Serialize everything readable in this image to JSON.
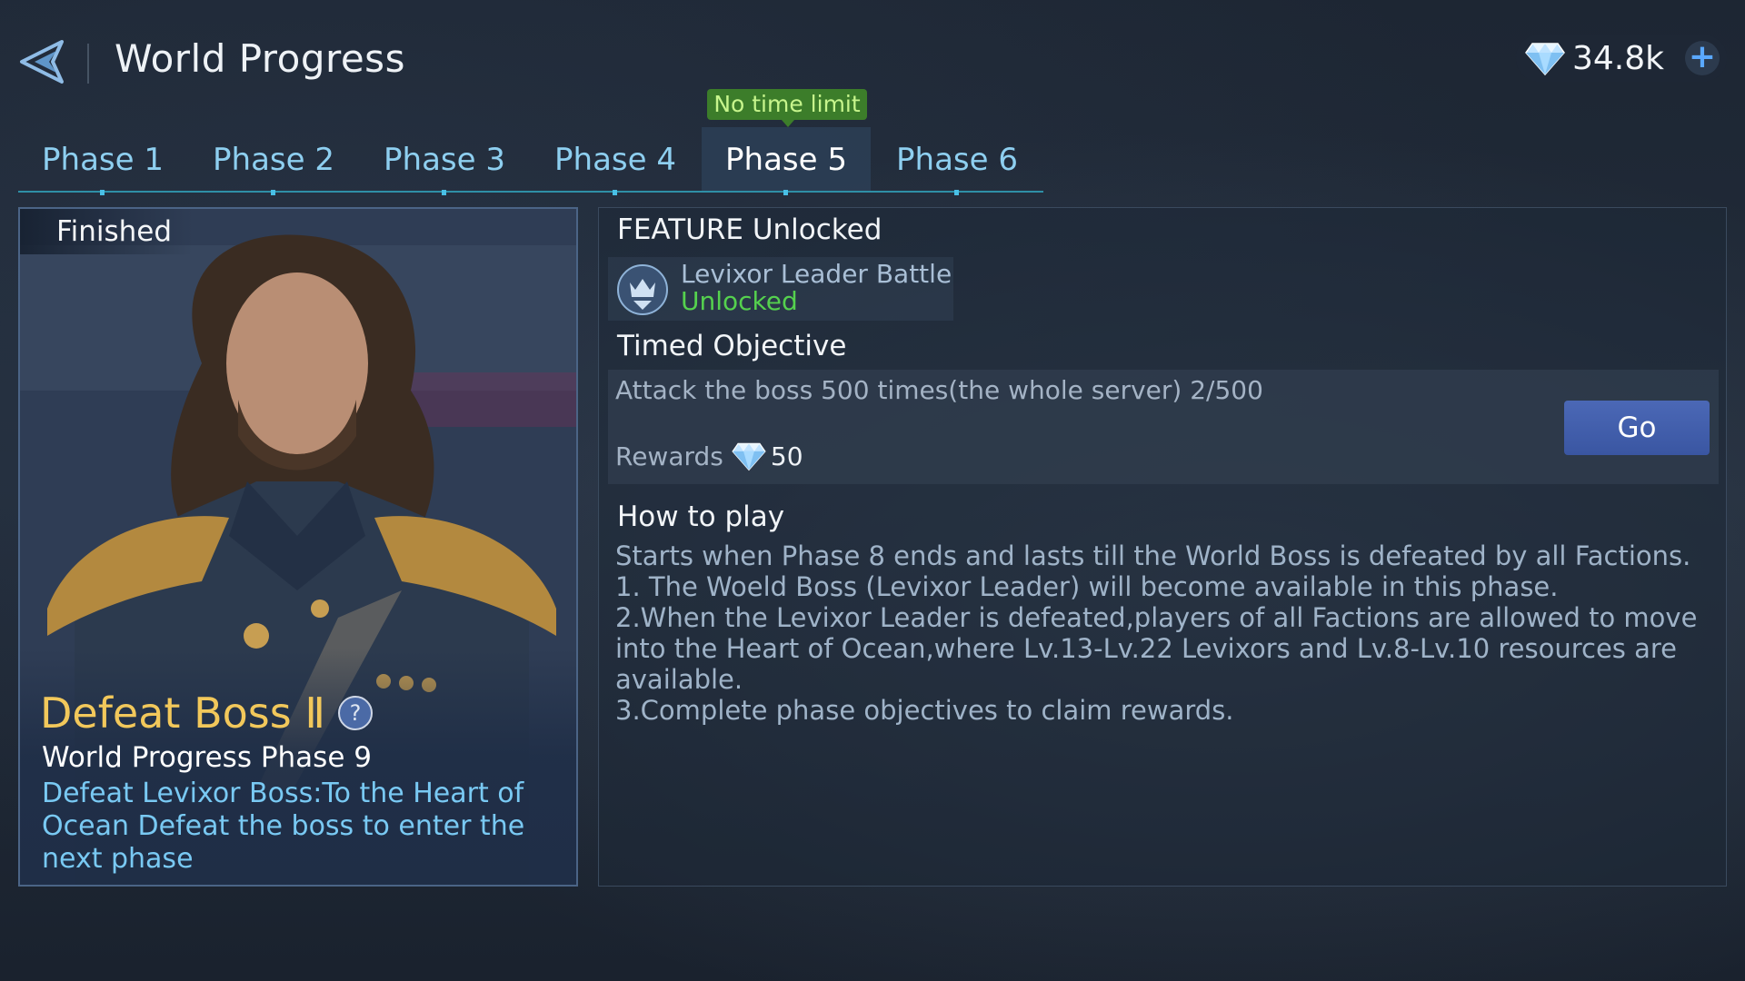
{
  "header": {
    "title": "World Progress",
    "currency_amount": "34.8k",
    "plus_label": "+"
  },
  "tabs": {
    "items": [
      {
        "label": "Phase 1"
      },
      {
        "label": "Phase 2"
      },
      {
        "label": "Phase 3"
      },
      {
        "label": "Phase 4"
      },
      {
        "label": "Phase 5"
      },
      {
        "label": "Phase 6"
      }
    ],
    "active": "Phase 5",
    "badge": "No time limit"
  },
  "card": {
    "status": "Finished",
    "boss_title": "Defeat Boss Ⅱ",
    "help_label": "?",
    "subtitle": "World Progress Phase 9",
    "description": "Defeat Levixor Boss:To the Heart of Ocean Defeat the boss to enter the next phase"
  },
  "feature": {
    "heading": "FEATURE Unlocked",
    "name": "Levixor Leader Battle",
    "status": "Unlocked"
  },
  "objective": {
    "heading": "Timed Objective",
    "text": "Attack the boss 500 times(the whole server) 2/500",
    "rewards_label": "Rewards",
    "reward_amount": "50",
    "go_label": "Go"
  },
  "howto": {
    "heading": "How to play",
    "text": "Starts when Phase 8 ends and lasts till the World Boss is defeated by all Factions.\n1. The Woeld Boss (Levixor Leader) will become available in this phase.\n2.When the Levixor Leader is defeated,players of all Factions are allowed to move into the Heart of Ocean,where Lv.13-Lv.22 Levixors and Lv.8-Lv.10 resources are available.\n3.Complete phase objectives to claim rewards."
  },
  "colors": {
    "accent": "#8ecff0",
    "gold": "#f2c85b",
    "green": "#55d14e",
    "button": "#4b68b6"
  },
  "icons": [
    "back-arrow-icon",
    "gem-icon",
    "plus-icon",
    "help-icon",
    "crown-shield-icon"
  ]
}
